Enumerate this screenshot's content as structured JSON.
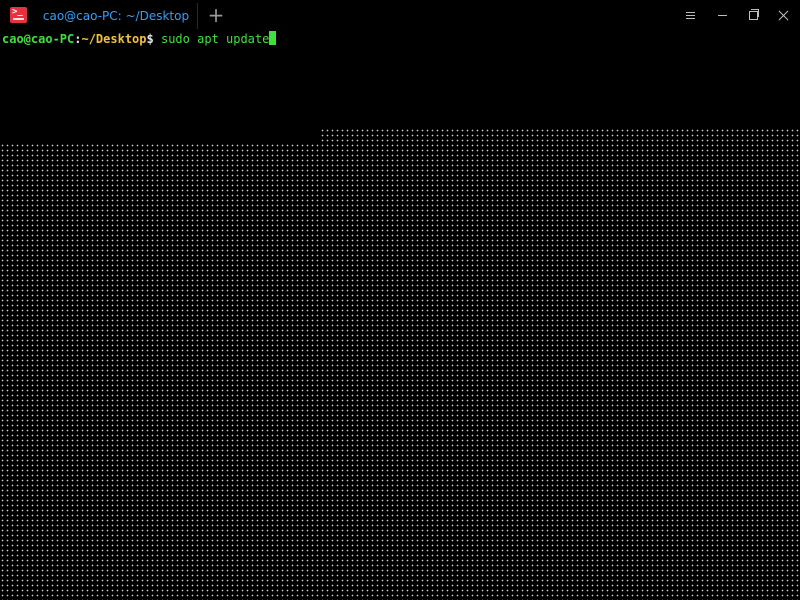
{
  "window": {
    "icon": "deepin-terminal-icon",
    "colors": {
      "background": "#000000",
      "tab_text": "#2fa0ff",
      "prompt_user": "#3ee03e",
      "prompt_path": "#f0c23a",
      "command": "#3ee03e",
      "cursor": "#3ee03e"
    }
  },
  "tabs": [
    {
      "label": "cao@cao-PC: ~/Desktop"
    }
  ],
  "titlebar": {
    "new_tab_label": "+",
    "controls": [
      "menu-icon",
      "minimize-icon",
      "maximize-icon",
      "close-icon"
    ]
  },
  "terminal": {
    "prompt_user_host": "cao@cao-PC",
    "prompt_colon": ":",
    "prompt_path": "~/Desktop",
    "prompt_symbol": "$",
    "command": " sudo apt update"
  }
}
